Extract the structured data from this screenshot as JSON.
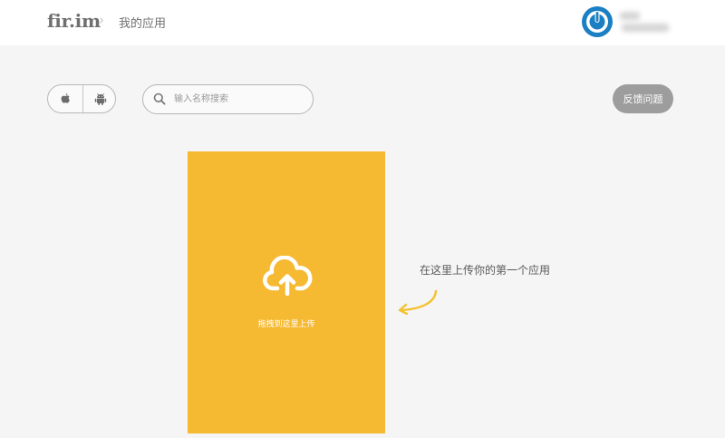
{
  "header": {
    "logo": "fir.im",
    "separator": "›",
    "breadcrumb": "我的应用"
  },
  "toolbar": {
    "platform_filter": {
      "options": [
        "ios-apple-icon",
        "android-icon"
      ]
    },
    "search": {
      "placeholder": "输入名称搜索",
      "value": ""
    },
    "feedback_label": "反馈问题"
  },
  "upload": {
    "label": "拖拽到这里上传",
    "icon": "cloud-upload-icon",
    "hint": "在这里上传你的第一个应用"
  },
  "colors": {
    "upload_card": "#f6b932",
    "accent_avatar": "#1b7fc3",
    "arrow": "#f5c12e",
    "feedback_button": "#9d9d9d"
  }
}
